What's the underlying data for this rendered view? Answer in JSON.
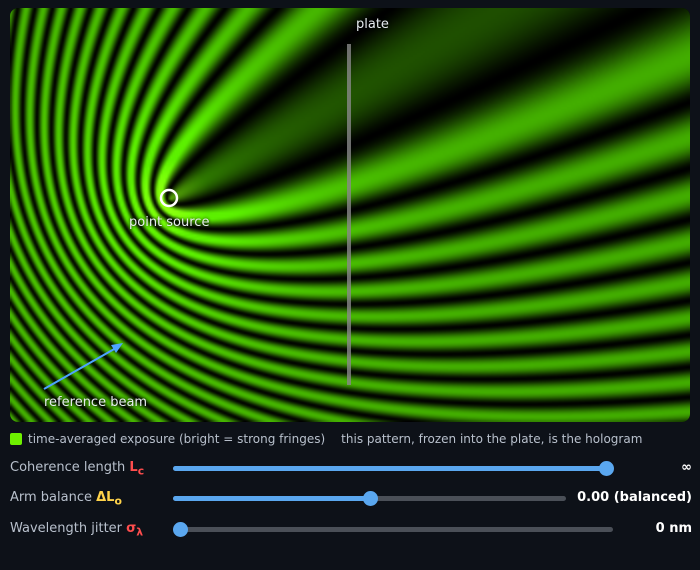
{
  "viewer": {
    "plate_label": "plate",
    "source_label": "point source",
    "beam_label": "reference beam",
    "fringe_color": "#5cf000",
    "plate_color": "#888888",
    "arrow_color": "#4da3ff"
  },
  "legend": {
    "swatch_color": "#6ef000",
    "text": "time-averaged exposure (bright = strong fringes)",
    "note": "this pattern, frozen into the plate, is the hologram"
  },
  "controls": [
    {
      "label": "Coherence length ",
      "symbol": "L",
      "sub": "c",
      "symbol_color": "red",
      "value_text": "∞",
      "fraction": 1.0
    },
    {
      "label": "Arm balance ",
      "symbol": "ΔL",
      "sub": "o",
      "symbol_color": "gold",
      "value_text": "0.00 (balanced)",
      "fraction": 0.5
    },
    {
      "label": "Wavelength jitter ",
      "symbol": "σ",
      "sub": "λ",
      "symbol_color": "red",
      "value_text": "0 nm",
      "fraction": 0.0
    }
  ]
}
